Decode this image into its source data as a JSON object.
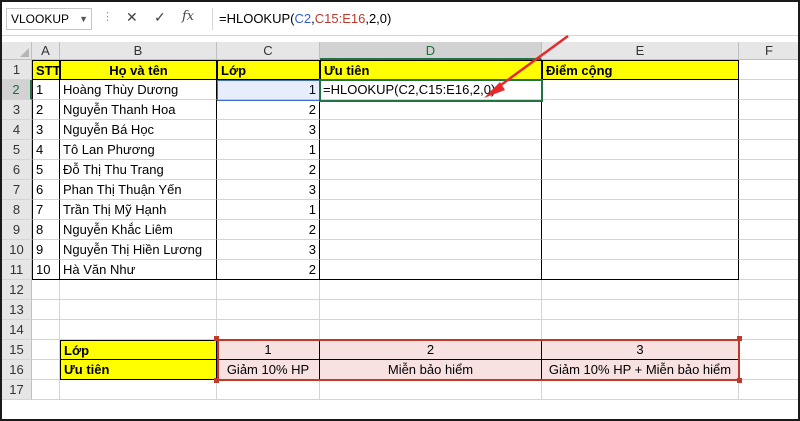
{
  "formula_bar": {
    "name_box": "VLOOKUP",
    "cancel_icon": "✕",
    "enter_icon": "✓",
    "fx_label": "fx",
    "formula_prefix": "=HLOOKUP(",
    "formula_ref1": "C2",
    "formula_comma1": ",",
    "formula_ref2": "C15:E16",
    "formula_suffix": ",2,0)"
  },
  "columns": [
    "A",
    "B",
    "C",
    "D",
    "E",
    "F"
  ],
  "rows": [
    "1",
    "2",
    "3",
    "4",
    "5",
    "6",
    "7",
    "8",
    "9",
    "10",
    "11",
    "12",
    "13",
    "14",
    "15",
    "16",
    "17"
  ],
  "headers": {
    "stt": "STT",
    "ho_ten": "Họ và tên",
    "lop": "Lớp",
    "uu_tien": "Ưu tiên",
    "diem_cong": "Điểm cộng"
  },
  "students": [
    {
      "stt": "1",
      "name": "Hoàng Thùy Dương",
      "lop": "1"
    },
    {
      "stt": "2",
      "name": "Nguyễn Thanh Hoa",
      "lop": "2"
    },
    {
      "stt": "3",
      "name": "Nguyễn Bá Học",
      "lop": "3"
    },
    {
      "stt": "4",
      "name": "Tô Lan Phương",
      "lop": "1"
    },
    {
      "stt": "5",
      "name": "Đỗ Thị Thu Trang",
      "lop": "2"
    },
    {
      "stt": "6",
      "name": "Phan Thị Thuận Yến",
      "lop": "3"
    },
    {
      "stt": "7",
      "name": "Trần Thị Mỹ Hạnh",
      "lop": "1"
    },
    {
      "stt": "8",
      "name": "Nguyễn Khắc Liêm",
      "lop": "2"
    },
    {
      "stt": "9",
      "name": "Nguyễn Thị Hiền Lương",
      "lop": "3"
    },
    {
      "stt": "10",
      "name": "Hà Văn Như",
      "lop": "2"
    }
  ],
  "editing_cell_text": "=HLOOKUP(C2,C15:E16,2,0)",
  "lookup_table": {
    "label_lop": "Lớp",
    "label_uu_tien": "Ưu tiên",
    "lop_values": [
      "1",
      "2",
      "3"
    ],
    "uu_tien_values": [
      "Giảm 10% HP",
      "Miễn bảo hiểm",
      "Giảm 10% HP + Miễn bảo hiểm"
    ]
  },
  "colors": {
    "header_fill": "#ffff00",
    "lookup_fill": "#f7e1e1",
    "active_border": "#217346",
    "ref_blue": "#3a6bd6",
    "ref_red": "#c0392b",
    "arrow": "#e8282b"
  }
}
